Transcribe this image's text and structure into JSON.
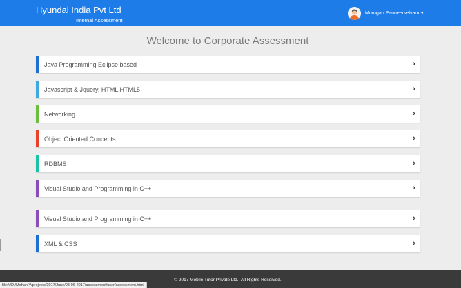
{
  "header": {
    "company": "Hyundai India Pvt Ltd",
    "subtitle": "Internal Assessment",
    "user_name": "Murugan Panneerselvam",
    "user_caret": "▾",
    "color": "#1d7ce8"
  },
  "main": {
    "title": "Welcome to Corporate Assessment",
    "courses": [
      {
        "label": "Java Programming Eclipse based",
        "accent": "#1d6fd1"
      },
      {
        "label": "Javascript & Jquery, HTML HTML5",
        "accent": "#3fa9e0"
      },
      {
        "label": "Networking",
        "accent": "#6abf3e"
      },
      {
        "label": "Object Oriented Concepts",
        "accent": "#e8422a"
      },
      {
        "label": "RDBMS",
        "accent": "#1bc3a6"
      },
      {
        "label": "Visual Studio and Programming in C++",
        "accent": "#8b4db8"
      },
      {
        "label": "Visual Studio and Programming in C++",
        "accent": "#8b4db8"
      },
      {
        "label": "XML & CSS",
        "accent": "#1d6fd1"
      }
    ],
    "chevron": "›"
  },
  "footer": {
    "copyright": "© 2017 Mobile Tutor Private Ltd., All Rights Reserved."
  },
  "status_bar": {
    "url": "file:///D:/Mohan.V/projects/2017/June/08-06-2017/assessment/user/assessment.html"
  },
  "icons": {
    "avatar": "user-avatar-icon",
    "chevron": "chevron-right-icon",
    "caret": "caret-down-icon"
  }
}
